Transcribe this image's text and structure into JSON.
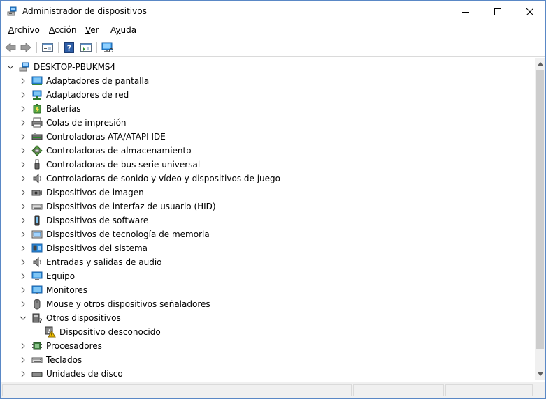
{
  "window": {
    "title": "Administrador de dispositivos"
  },
  "menubar": {
    "items": [
      {
        "label": "Archivo"
      },
      {
        "label": "Acción"
      },
      {
        "label": "Ver"
      },
      {
        "label": "Ayuda"
      }
    ]
  },
  "toolbar": {
    "icons": [
      "back-arrow-icon",
      "forward-arrow-icon",
      "properties-icon",
      "help-icon",
      "show-hidden-icon",
      "monitor-scan-icon"
    ]
  },
  "tree": {
    "root": {
      "label": "DESKTOP-PBUKMS4",
      "expanded": true
    },
    "categories": [
      {
        "label": "Adaptadores de pantalla",
        "icon": "display-adapter-icon",
        "expanded": false
      },
      {
        "label": "Adaptadores de red",
        "icon": "network-adapter-icon",
        "expanded": false
      },
      {
        "label": "Baterías",
        "icon": "battery-icon",
        "expanded": false
      },
      {
        "label": "Colas de impresión",
        "icon": "print-queue-icon",
        "expanded": false
      },
      {
        "label": "Controladoras ATA/ATAPI IDE",
        "icon": "ide-controller-icon",
        "expanded": false
      },
      {
        "label": "Controladoras de almacenamiento",
        "icon": "storage-controller-icon",
        "expanded": false
      },
      {
        "label": "Controladoras de bus serie universal",
        "icon": "usb-icon",
        "expanded": false
      },
      {
        "label": "Controladoras de sonido y vídeo y dispositivos de juego",
        "icon": "speaker-icon",
        "expanded": false
      },
      {
        "label": "Dispositivos de imagen",
        "icon": "camera-icon",
        "expanded": false
      },
      {
        "label": "Dispositivos de interfaz de usuario (HID)",
        "icon": "hid-icon",
        "expanded": false
      },
      {
        "label": "Dispositivos de software",
        "icon": "software-device-icon",
        "expanded": false
      },
      {
        "label": "Dispositivos de tecnología de memoria",
        "icon": "memory-icon",
        "expanded": false
      },
      {
        "label": "Dispositivos del sistema",
        "icon": "system-device-icon",
        "expanded": false
      },
      {
        "label": "Entradas y salidas de audio",
        "icon": "audio-icon",
        "expanded": false
      },
      {
        "label": "Equipo",
        "icon": "computer-icon",
        "expanded": false
      },
      {
        "label": "Monitores",
        "icon": "monitor-icon",
        "expanded": false
      },
      {
        "label": "Mouse y otros dispositivos señaladores",
        "icon": "mouse-icon",
        "expanded": false
      },
      {
        "label": "Otros dispositivos",
        "icon": "other-devices-icon",
        "expanded": true
      },
      {
        "label": "Dispositivo desconocido",
        "icon": "unknown-device-warning-icon",
        "child": true
      },
      {
        "label": "Procesadores",
        "icon": "processor-icon",
        "expanded": false
      },
      {
        "label": "Teclados",
        "icon": "keyboard-icon",
        "expanded": false
      },
      {
        "label": "Unidades de disco",
        "icon": "disk-drive-icon",
        "expanded": false
      }
    ]
  },
  "colors": {
    "window_border": "#5a88c6",
    "icon_blue": "#1f8ed8",
    "warning_yellow": "#f3c200"
  }
}
